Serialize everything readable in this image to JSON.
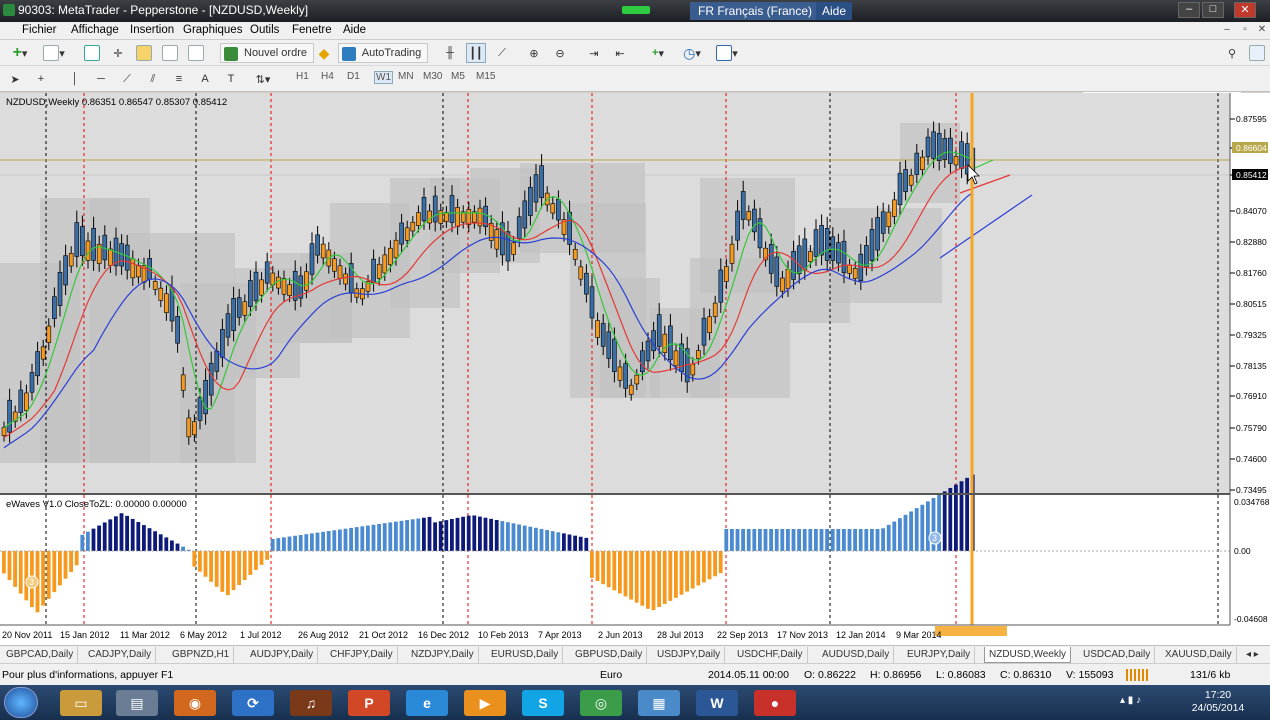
{
  "window": {
    "title": "90303: MetaTrader - Pepperstone - [NZDUSD,Weekly]",
    "lang": "FR Français (France)",
    "help": "Aide"
  },
  "menu": [
    "Fichier",
    "Affichage",
    "Insertion",
    "Graphiques",
    "Outils",
    "Fenetre",
    "Aide"
  ],
  "toolbar": {
    "new_order": "Nouvel ordre",
    "autotrading": "AutoTrading"
  },
  "timeframes": [
    "H1",
    "H4",
    "D1",
    "W1",
    "MN",
    "M30",
    "M5",
    "M15"
  ],
  "chart": {
    "header": "NZDUSD,Weekly  0.86351 0.86547 0.85307 0.85412",
    "indicator_header": "eWaves V1.0 CloseToZL: 0.00000 0.00000",
    "price_labels": [
      "0.87595",
      "0.86604",
      "0.85412",
      "0.84070",
      "0.82880",
      "0.81760",
      "0.80515",
      "0.79325",
      "0.78135",
      "0.76910",
      "0.75790",
      "0.74600",
      "0.73495"
    ],
    "ind_labels": [
      "0.034768",
      "0.00",
      "-0.04608"
    ],
    "dates": [
      "20 Nov 2011",
      "15 Jan 2012",
      "11 Mar 2012",
      "6 May 2012",
      "1 Jul 2012",
      "26 Aug 2012",
      "21 Oct 2012",
      "16 Dec 2012",
      "10 Feb 2013",
      "7 Apr 2013",
      "2 Jun 2013",
      "28 Jul 2013",
      "22 Sep 2013",
      "17 Nov 2013",
      "12 Jan 2014",
      "9 Mar 2014"
    ],
    "wave_marker": "3",
    "colors": {
      "bull": "#3a6ea5",
      "bear": "#f59a1e",
      "ma_green": "#33c83a",
      "ma_red": "#e53935",
      "ma_blue": "#2b3fd6",
      "cursor": "#f5a623",
      "hist_dark": "#0d1a7a",
      "hist_light": "#4a8ad0"
    }
  },
  "tabs": [
    "GBPCAD,Daily",
    "CADJPY,Daily",
    "GBPNZD,H1",
    "AUDJPY,Daily",
    "CHFJPY,Daily",
    "NZDJPY,Daily",
    "EURUSD,Daily",
    "GBPUSD,Daily",
    "USDJPY,Daily",
    "USDCHF,Daily",
    "AUDUSD,Daily",
    "EURJPY,Daily",
    "NZDUSD,Weekly",
    "USDCAD,Daily",
    "XAUUSD,Daily"
  ],
  "active_tab": "NZDUSD,Weekly",
  "status": {
    "help": "Pour plus d'informations, appuyer F1",
    "profile": "Euro",
    "datetime": "2014.05.11 00:00",
    "open": "O: 0.86222",
    "high": "H: 0.86956",
    "low": "L: 0.86083",
    "close": "C: 0.86310",
    "volume": "V: 155093",
    "net": "131/6 kb"
  },
  "clock": {
    "time": "17:20",
    "date": "24/05/2014"
  }
}
